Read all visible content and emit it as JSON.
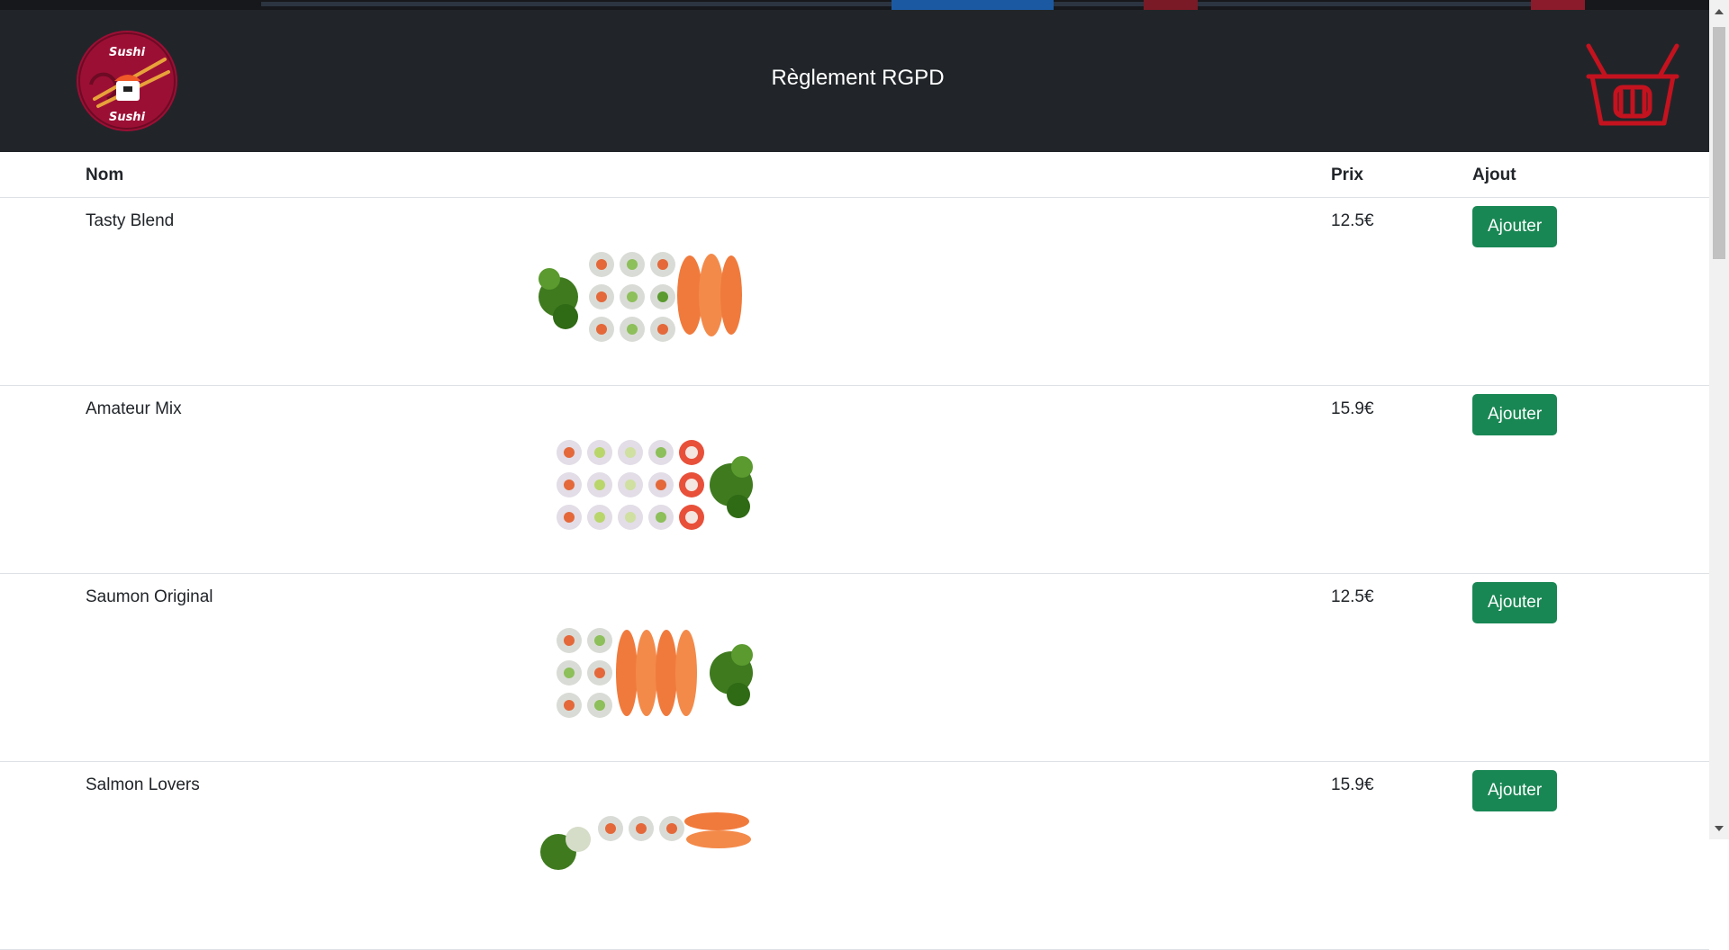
{
  "header": {
    "title": "Règlement RGPD",
    "logo_icon": "sushi-logo-icon",
    "cart_icon": "basket-icon",
    "accent_color": "#c4121f"
  },
  "table": {
    "columns": [
      "Nom",
      "",
      "Prix",
      "Ajout"
    ],
    "rows": [
      {
        "name": "Tasty Blend",
        "image": "sushi-platter-image",
        "price": "12.5€",
        "action": "Ajouter"
      },
      {
        "name": "Amateur Mix",
        "image": "sushi-platter-image",
        "price": "15.9€",
        "action": "Ajouter"
      },
      {
        "name": "Saumon Original",
        "image": "sushi-platter-image",
        "price": "12.5€",
        "action": "Ajouter"
      },
      {
        "name": "Salmon Lovers",
        "image": "sushi-platter-image",
        "price": "15.9€",
        "action": "Ajouter"
      }
    ]
  },
  "colors": {
    "header_bg": "#212529",
    "button_bg": "#198754"
  }
}
